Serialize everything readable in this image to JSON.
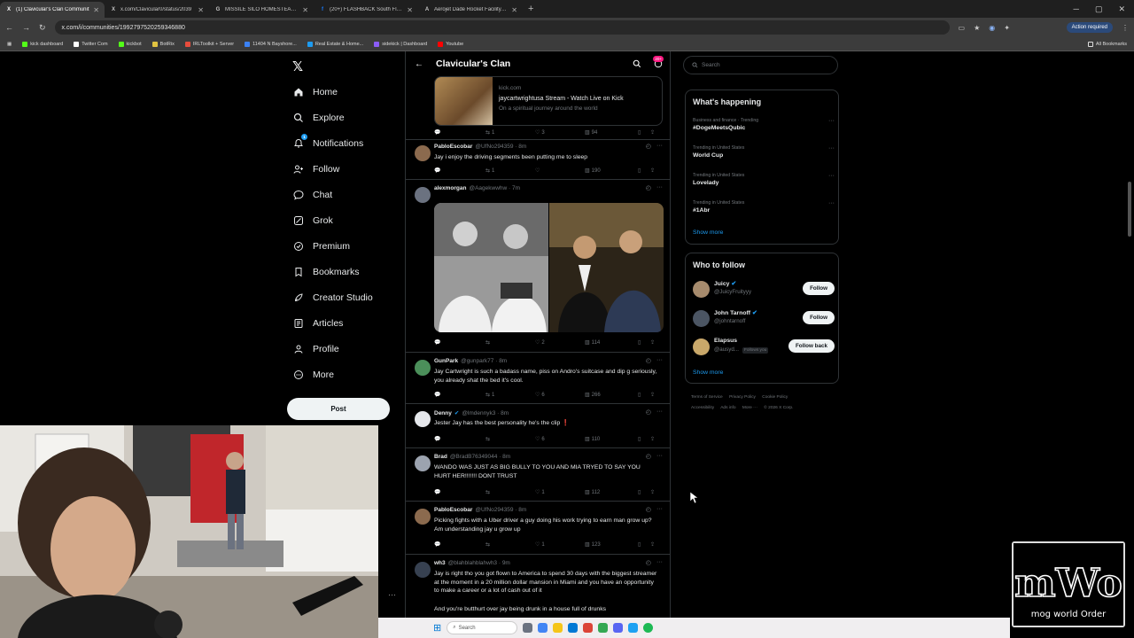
{
  "browser": {
    "tabs": [
      {
        "title": "(1) Clavicular's Clan Communit",
        "icon": "X",
        "active": true
      },
      {
        "title": "x.com/Clavicular0/status/2039",
        "icon": "X",
        "active": false
      },
      {
        "title": "MISSILE SILO HOMESTEAD - G",
        "icon": "G",
        "active": false
      },
      {
        "title": "(20+) FLASHBACK South Florid",
        "icon": "f",
        "active": false
      },
      {
        "title": "Aerojet Dade Rocket Facility | A",
        "icon": "A",
        "active": false
      }
    ],
    "url": "x.com/i/communities/1992797520259346880",
    "action_required": "Action required",
    "bookmarks": [
      {
        "label": "kick dashboard",
        "color": "#53fc18"
      },
      {
        "label": "Twitter Com",
        "color": "#ffffff"
      },
      {
        "label": "kickbot",
        "color": "#53fc18"
      },
      {
        "label": "BotRix",
        "color": "#e0c341"
      },
      {
        "label": "IRLToolkit + Server",
        "color": "#e74c3c"
      },
      {
        "label": "11404 N Bayshore...",
        "color": "#3b82f6"
      },
      {
        "label": "Real Estate & Home...",
        "color": "#1d9bf0"
      },
      {
        "label": "sidekick | Dashboard",
        "color": "#8b5cf6"
      },
      {
        "label": "Youtube",
        "color": "#ff0000"
      }
    ],
    "all_bookmarks": "All Bookmarks"
  },
  "sidebar": {
    "items": [
      {
        "label": "Home",
        "icon": "home-icon"
      },
      {
        "label": "Explore",
        "icon": "search-icon"
      },
      {
        "label": "Notifications",
        "icon": "bell-icon"
      },
      {
        "label": "Follow",
        "icon": "person-add-icon"
      },
      {
        "label": "Chat",
        "icon": "chat-icon"
      },
      {
        "label": "Grok",
        "icon": "grok-icon"
      },
      {
        "label": "Premium",
        "icon": "premium-icon"
      },
      {
        "label": "Bookmarks",
        "icon": "bookmark-icon"
      },
      {
        "label": "Creator Studio",
        "icon": "rocket-icon"
      },
      {
        "label": "Articles",
        "icon": "articles-icon"
      },
      {
        "label": "Profile",
        "icon": "profile-icon"
      },
      {
        "label": "More",
        "icon": "more-icon"
      }
    ],
    "post_label": "Post",
    "notifications_badge": "1"
  },
  "community": {
    "title": "Clavicular's Clan",
    "badge": "20+"
  },
  "link_card": {
    "domain": "kick.com",
    "title": "jaycartwrightusa Stream - Watch Live on Kick",
    "desc": "On a spiritual journey around the world",
    "replies": "",
    "retweets": "1",
    "likes": "3",
    "views": "94"
  },
  "posts": [
    {
      "name": "PabloEscobar",
      "handle": "@UfNo294359 · 8m",
      "text": "Jay i enjoy the driving segments been putting me to sleep",
      "replies": "",
      "retweets": "1",
      "likes": "",
      "views": "190",
      "avatar_color": "#8b6a4e"
    },
    {
      "name": "alexmorgan",
      "handle": "@Aagekwwhw · 7m",
      "text": "",
      "replies": "",
      "retweets": "",
      "likes": "2",
      "views": "114",
      "avatar_color": "#6b7280"
    },
    {
      "name": "GunPark",
      "handle": "@gunpark77 · 8m",
      "text": "Jay Cartwright is such a badass name, piss on Andro's suitcase and dip g seriously, you already shat the bed it's cool.",
      "replies": "",
      "retweets": "1",
      "likes": "6",
      "views": "266",
      "avatar_color": "#4b8f5a"
    },
    {
      "name": "Denny",
      "handle": "@lmdennyk3 · 8m",
      "text": "Jester Jay has the best personality he's the clip",
      "emoji": "❗",
      "replies": "",
      "retweets": "",
      "likes": "6",
      "views": "110",
      "avatar_color": "#e5e7eb"
    },
    {
      "name": "Brad",
      "handle": "@BradB76349044 · 8m",
      "text": "WANDO WAS JUST AS BIG BULLY TO YOU AND MIA TRYED TO SAY YOU HURT HER!!!!!!! DONT TRUST",
      "replies": "",
      "retweets": "",
      "likes": "1",
      "views": "112",
      "avatar_color": "#9ca3af"
    },
    {
      "name": "PabloEscobar",
      "handle": "@UfNo294359 · 8m",
      "text": "Picking fights with a Uber driver a guy doing his work trying to earn man grow up? Am understanding jay u grow up",
      "replies": "",
      "retweets": "",
      "likes": "1",
      "views": "123",
      "avatar_color": "#8b6a4e"
    },
    {
      "name": "wh3",
      "handle": "@blahblahblahwh3 · 9m",
      "text": "Jay is right tho you got flown to America to spend 30 days with the biggest streamer at the moment in a 20 million dollar mansion in Miami and you have an opportunity to make a career or a lot of cash out of it",
      "text2": "And you're butthurt over jay being drunk in a house full of drunks",
      "avatar_color": "#374151"
    }
  ],
  "right": {
    "search_placeholder": "Search",
    "whats_happening": "What's happening",
    "trends": [
      {
        "context": "Business and finance · Trending",
        "name": "#DogeMeetsQubic"
      },
      {
        "context": "Trending in United States",
        "name": "World Cup"
      },
      {
        "context": "Trending in United States",
        "name": "Lovelady"
      },
      {
        "context": "Trending in United States",
        "name": "#1Abr"
      }
    ],
    "show_more": "Show more",
    "who_to_follow": "Who to follow",
    "follow_suggestions": [
      {
        "name": "Juicy",
        "handle": "@JuicyFruityyy",
        "button": "Follow",
        "verified": true,
        "avatar_color": "#a78b6d"
      },
      {
        "name": "John Tarnoff",
        "handle": "@johntarnoff",
        "button": "Follow",
        "verified": true,
        "avatar_color": "#4b5563"
      },
      {
        "name": "Elapsus",
        "handle": "@ausyd...",
        "button": "Follow back",
        "follows_you": "Follows you",
        "verified": false,
        "avatar_color": "#c9a86a"
      }
    ],
    "show_more2": "Show more",
    "footer": [
      "Terms of Service",
      "Privacy Policy",
      "Cookie Policy",
      "Accessibility",
      "Ads info",
      "More ···",
      "© 2026 X Corp."
    ]
  },
  "overlay": {
    "logo_text": "mWo",
    "logo_sub": "mog world Order"
  },
  "taskbar": {
    "search_placeholder": "Search"
  }
}
